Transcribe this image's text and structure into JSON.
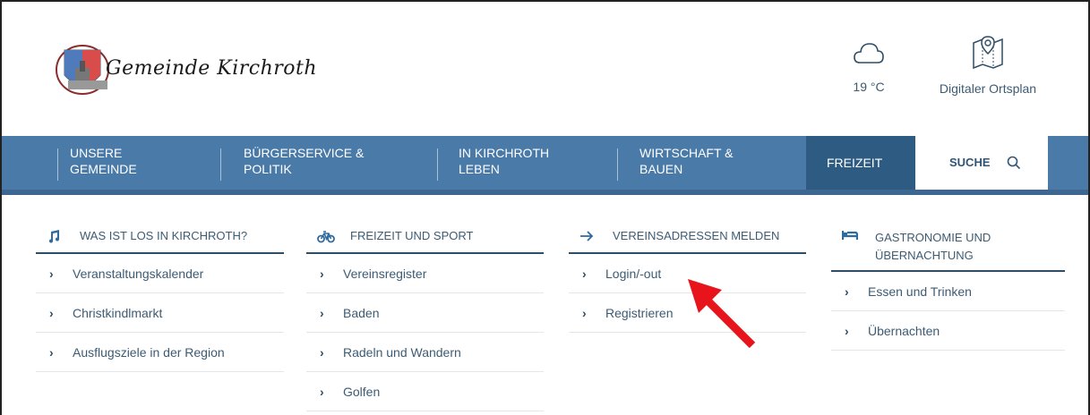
{
  "header": {
    "logo_text": "Gemeinde Kirchroth",
    "weather_temp": "19 °C",
    "ortsplan_label": "Digitaler Ortsplan"
  },
  "nav": {
    "items": [
      {
        "line1": "UNSERE",
        "line2": "GEMEINDE"
      },
      {
        "line1": "BÜRGERSERVICE &",
        "line2": "POLITIK"
      },
      {
        "line1": "IN KIRCHROTH",
        "line2": "LEBEN"
      },
      {
        "line1": "WIRTSCHAFT &",
        "line2": "BAUEN"
      }
    ],
    "active": "FREIZEIT",
    "search": "SUCHE"
  },
  "menu": {
    "col1": {
      "heading": "WAS IST LOS IN KIRCHROTH?",
      "icon": "music-note-icon",
      "items": [
        "Veranstaltungskalender",
        "Christkindlmarkt",
        "Ausflugsziele in der Region"
      ]
    },
    "col2": {
      "heading": "FREIZEIT UND SPORT",
      "icon": "bicycle-icon",
      "items": [
        "Vereinsregister",
        "Baden",
        "Radeln und Wandern",
        "Golfen"
      ]
    },
    "col3": {
      "heading": "VEREINSADRESSEN MELDEN",
      "icon": "arrow-right-icon",
      "items": [
        "Login/-out",
        "Registrieren"
      ]
    },
    "col4": {
      "heading_line1": "GASTRONOMIE UND",
      "heading_line2": "ÜBERNACHTUNG",
      "icon": "bed-icon",
      "items": [
        "Essen und Trinken",
        "Übernachten"
      ]
    }
  },
  "annotation": {
    "color": "#e8141b",
    "target": "Login/-out"
  },
  "colors": {
    "nav": "#4a7aa8",
    "nav_active": "#2e5b82",
    "text": "#3d5b73"
  }
}
